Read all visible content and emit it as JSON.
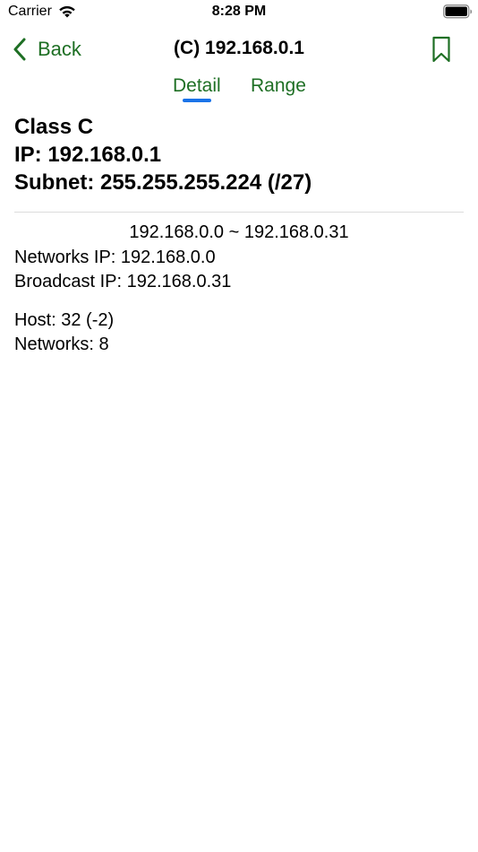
{
  "status_bar": {
    "carrier": "Carrier",
    "time": "8:28 PM"
  },
  "nav": {
    "back_label": "Back",
    "title": "(C) 192.168.0.1"
  },
  "tabs": [
    {
      "label": "Detail",
      "selected": true
    },
    {
      "label": "Range",
      "selected": false
    }
  ],
  "summary": {
    "class_line": "Class C",
    "ip_line": "IP: 192.168.0.1",
    "subnet_line": "Subnet: 255.255.255.224 (/27)"
  },
  "details": {
    "range": "192.168.0.0 ~ 192.168.0.31",
    "network_ip": "Networks IP: 192.168.0.0",
    "broadcast_ip": "Broadcast IP: 192.168.0.31",
    "hosts": "Host: 32 (-2)",
    "networks": "Networks: 8"
  },
  "colors": {
    "accent": "#1e6f24",
    "tab_indicator": "#1a73e8",
    "divider": "#dcdcdc"
  },
  "icons": {
    "wifi": "wifi-icon",
    "battery": "battery-icon",
    "back": "chevron-left-icon",
    "bookmark": "bookmark-icon"
  }
}
